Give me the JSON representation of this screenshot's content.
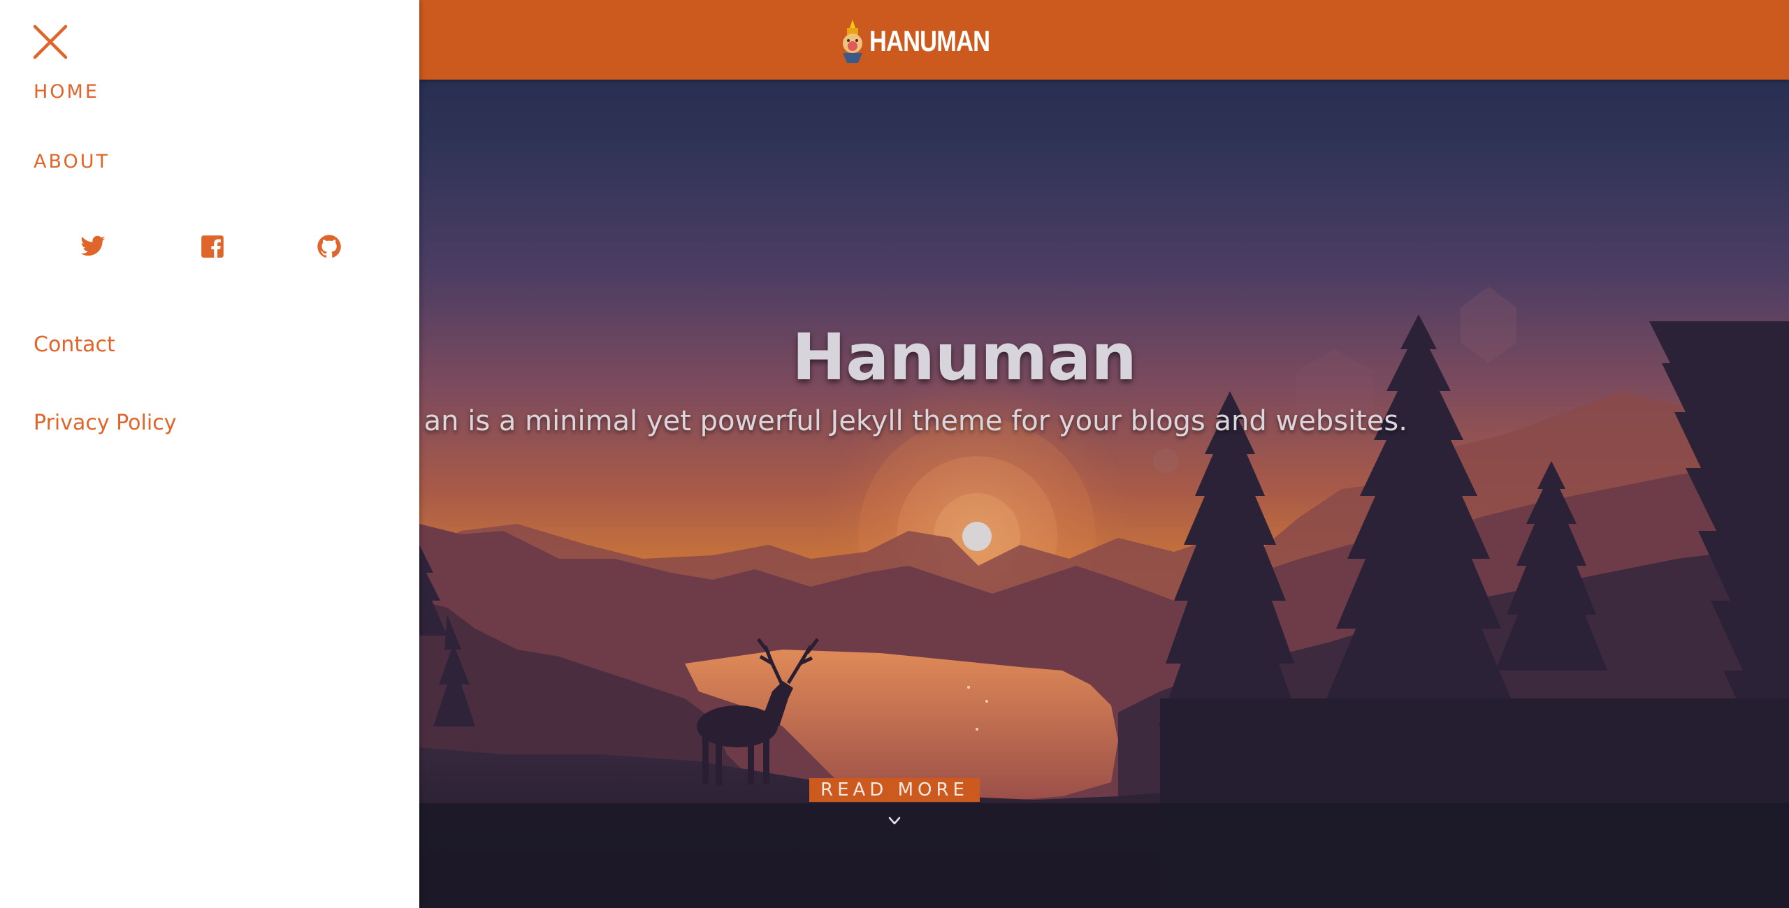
{
  "navbar": {
    "brand_text": "HANUMAN",
    "bg_color": "#cc5a1e"
  },
  "hero": {
    "title": "Hanuman",
    "subtitle": "an is a minimal yet powerful Jekyll theme for your blogs and websites.",
    "read_more_label": "READ MORE",
    "scroll_icon": "chevron-down-icon"
  },
  "sidebar": {
    "close_icon": "close-icon",
    "links": {
      "home": "HOME",
      "about": "ABOUT",
      "contact": "Contact",
      "privacy": "Privacy Policy"
    },
    "social_icons": [
      "twitter-icon",
      "facebook-icon",
      "github-icon"
    ],
    "accent_color": "#e0652a"
  }
}
